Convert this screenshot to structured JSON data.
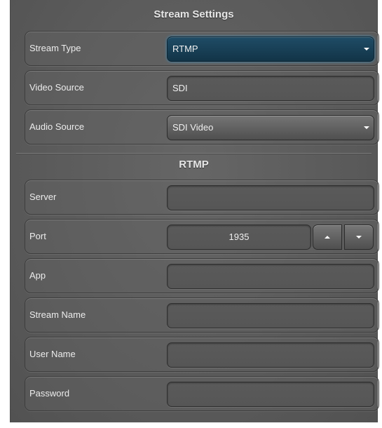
{
  "title": "Stream Settings",
  "stream_type": {
    "label": "Stream Type",
    "value": "RTMP"
  },
  "video_source": {
    "label": "Video Source",
    "value": "SDI"
  },
  "audio_source": {
    "label": "Audio Source",
    "value": "SDI Video"
  },
  "rtmp_section": {
    "title": "RTMP"
  },
  "server": {
    "label": "Server",
    "value": ""
  },
  "port": {
    "label": "Port",
    "value": "1935"
  },
  "app": {
    "label": "App",
    "value": ""
  },
  "stream_name": {
    "label": "Stream Name",
    "value": ""
  },
  "user_name": {
    "label": "User Name",
    "value": ""
  },
  "password": {
    "label": "Password",
    "value": ""
  },
  "icons": {
    "stream_type_caret": "chevron-down-icon",
    "audio_source_caret": "chevron-down-icon",
    "port_up": "triangle-up-icon",
    "port_down": "triangle-down-icon"
  },
  "colors": {
    "panel_background": "#5e5e5e",
    "selected_dropdown": "#1a3f55",
    "focus_glow": "#3f8ab5"
  }
}
